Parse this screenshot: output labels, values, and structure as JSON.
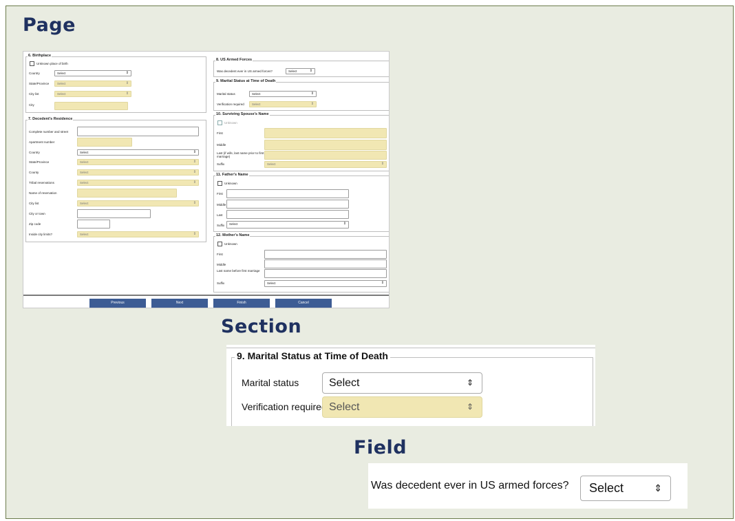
{
  "headings": {
    "page": "Page",
    "section": "Section",
    "field": "Field"
  },
  "page": {
    "s6": {
      "title": "6. Birthplace",
      "unknown": "Unknown place of birth",
      "country_label": "Country",
      "country_value": "Select",
      "state_label": "State/Province",
      "state_value": "Select",
      "citylist_label": "City list",
      "citylist_value": "Select",
      "city_label": "City"
    },
    "s7": {
      "title": "7. Decedent's Residence",
      "street_label": "Complete number and street",
      "apt_label": "Apartment number",
      "country_label": "Country",
      "country_value": "Select",
      "state_label": "State/Province",
      "state_value": "Select",
      "county_label": "County",
      "county_value": "Select",
      "tribal_label": "Tribal reservations",
      "tribal_value": "Select",
      "resname_label": "Name of reservation",
      "citylist_label": "City list",
      "citylist_value": "Select",
      "town_label": "City or town",
      "zip_label": "Zip code",
      "limits_label": "Inside city limits?",
      "limits_value": "Select"
    },
    "s8": {
      "title": "8. US Armed Forces",
      "question": "Was decedent ever in US armed forces?",
      "value": "Select"
    },
    "s9": {
      "title": "9. Marital Status at Time of Death",
      "marital_label": "Marital status",
      "marital_value": "Select",
      "verif_label": "Verification required",
      "verif_value": "Select"
    },
    "s10": {
      "title": "10. Surviving Spouse's Name",
      "unknown": "Unknown",
      "first": "First",
      "middle": "Middle",
      "last": "Last (if wife, last name prior to first marriage)",
      "suffix": "Suffix",
      "suffix_value": "Select"
    },
    "s11": {
      "title": "11. Father's Name",
      "unknown": "Unknown",
      "first": "First",
      "middle": "Middle",
      "last": "Last",
      "suffix": "Suffix",
      "suffix_value": "Select"
    },
    "s12": {
      "title": "12. Mother's Name",
      "unknown": "Unknown",
      "first": "First",
      "middle": "Middle",
      "last": "Last name before first marriage",
      "suffix": "Suffix",
      "suffix_value": "Select"
    },
    "buttons": {
      "previous": "Previous",
      "next": "Next",
      "finish": "Finish",
      "cancel": "Cancel"
    }
  },
  "section": {
    "title": "9. Marital Status at Time of Death",
    "marital_label": "Marital status",
    "marital_value": "Select",
    "verif_label": "Verification required",
    "verif_value": "Select"
  },
  "field": {
    "question": "Was decedent ever in US armed forces?",
    "value": "Select"
  },
  "icons": {
    "select_arrow": "⇕"
  }
}
